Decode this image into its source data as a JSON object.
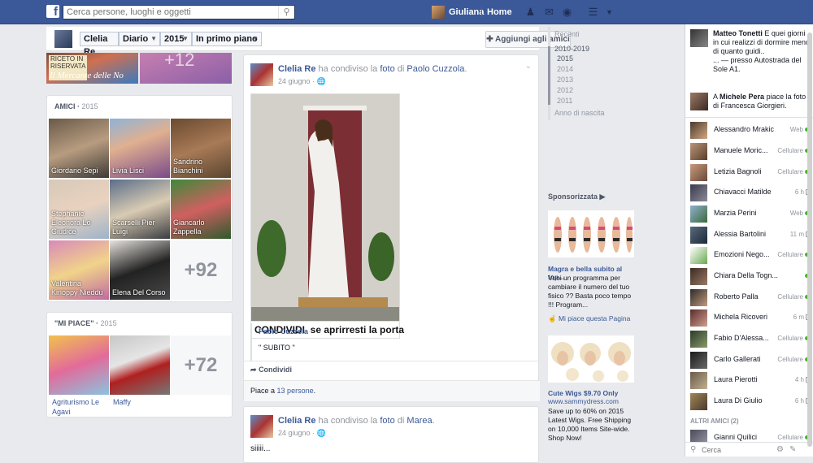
{
  "topbar": {
    "search_placeholder": "Cerca persone, luoghi e oggetti",
    "user_name": "Giuliana",
    "home_label": "Home",
    "brand_color": "#3b5998",
    "icons": [
      "friends-icon",
      "messages-icon",
      "notifications-icon",
      "privacy-icon",
      "settings-icon"
    ]
  },
  "profile_nav": {
    "name": "Clelia Re",
    "section": "Diario",
    "year": "2015",
    "filter": "In primo piano",
    "add_friend_label": "Aggiungi agli amici"
  },
  "covers": {
    "tag_text": "RICETO IN\nRISERVATA",
    "caption": "Il Mercante delle No",
    "count_text": "+12"
  },
  "friends": {
    "title": "AMICI",
    "year": "2015",
    "tiles": [
      {
        "name": "Giordano Sepi"
      },
      {
        "name": "Livia Lisci"
      },
      {
        "name": "Sandrino Bianchini"
      },
      {
        "name": "Stephanie Eleonora Lo Giudice"
      },
      {
        "name": "Scarselli Pier Luigi"
      },
      {
        "name": "Giancarlo Zappella"
      },
      {
        "name": "Valentina Kinoppy Nieddu"
      },
      {
        "name": "Elena Del Corso"
      }
    ],
    "more": "+92"
  },
  "likes": {
    "title": "\"MI PIACE\"",
    "year": "2015",
    "items": [
      {
        "name": "Agriturismo Le Agavi"
      },
      {
        "name": "Maffy"
      }
    ],
    "more": "+72"
  },
  "post1": {
    "author": "Clelia Re",
    "verb1": "ha condiviso la",
    "object": "foto",
    "verb2": "di",
    "source": "Paolo Cuzzola",
    "date": "24 giugno",
    "caption": "CONDIVIDI  se aprirresti la porta",
    "shared_author": "Paolo Cuzzola",
    "shared_text": "\" SUBITO \"",
    "share_label": "Condividi",
    "likes_prefix": "Piace a",
    "likes_count": "13 persone",
    "likes_suffix": "."
  },
  "post2": {
    "author": "Clelia Re",
    "verb1": "ha condiviso la",
    "object": "foto",
    "verb2": "di",
    "source": "Marea",
    "date": "24 giugno",
    "text": "siiiii..."
  },
  "timeline_nav": {
    "recent": "Recenti",
    "range": "2010-2019",
    "years": [
      "2015",
      "2014",
      "2013",
      "2012",
      "2011"
    ],
    "birth": "Anno di nascita"
  },
  "sponsored": {
    "title": "Sponsorizzata",
    "ads": [
      {
        "title": "Magra e bella subito al top...",
        "body": "Vuoi un programma per cambiare il numero del tuo fisico ?? Basta poco tempo !!! Program...",
        "like_label": "Mi piace questa Pagina"
      },
      {
        "title": "Cute Wigs $9.70 Only",
        "domain": "www.sammydress.com",
        "body": "Save up to 60% on 2015 Latest Wigs. Free Shipping on 10,000 Items Site-wide. Shop Now!"
      }
    ]
  },
  "ticker": [
    {
      "name": "Matteo Tonetti",
      "text": "E quei giorni in cui realizzi di dormire meno di quanto guidi..",
      "meta": "... — presso Autostrada del Sole A1."
    },
    {
      "prefix": "A",
      "name": "Michele Pera",
      "text": "piace la foto di Francesca Giorgieri."
    }
  ],
  "chat": {
    "contacts": [
      {
        "name": "Alessandro Mrakic",
        "status": "Web",
        "kind": "dot"
      },
      {
        "name": "Manuele Moric...",
        "status": "Cellulare",
        "kind": "dot"
      },
      {
        "name": "Letizia Bagnoli",
        "status": "Cellulare",
        "kind": "dot"
      },
      {
        "name": "Chiavacci Matilde",
        "status": "6 h",
        "kind": "mob"
      },
      {
        "name": "Marzia Perini",
        "status": "Web",
        "kind": "dot"
      },
      {
        "name": "Alessia Bartolini",
        "status": "11 m",
        "kind": "mob"
      },
      {
        "name": "Emozioni Nego...",
        "status": "Cellulare",
        "kind": "dot"
      },
      {
        "name": "Chiara Della Togn...",
        "status": "",
        "kind": "dot"
      },
      {
        "name": "Roberto Palla",
        "status": "Cellulare",
        "kind": "dot"
      },
      {
        "name": "Michela Ricoveri",
        "status": "6 m",
        "kind": "mob"
      },
      {
        "name": "Fabio D'Alessa...",
        "status": "Cellulare",
        "kind": "dot"
      },
      {
        "name": "Carlo Gallerati",
        "status": "Cellulare",
        "kind": "dot"
      },
      {
        "name": "Laura Pierotti",
        "status": "4 h",
        "kind": "mob"
      },
      {
        "name": "Laura Di Giulio",
        "status": "6 h",
        "kind": "mob"
      }
    ],
    "other_header": "ALTRI AMICI (2)",
    "other": [
      {
        "name": "Gianni Quilici",
        "status": "Cellulare",
        "kind": "dot"
      }
    ],
    "search_placeholder": "Cerca"
  }
}
